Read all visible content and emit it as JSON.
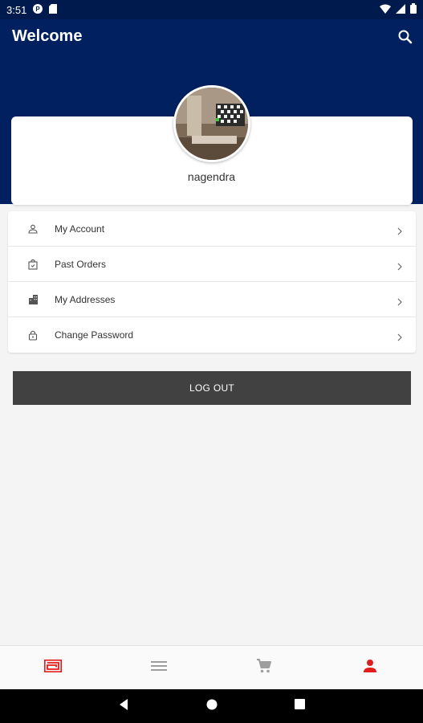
{
  "status_bar": {
    "time": "3:51"
  },
  "header": {
    "title": "Welcome"
  },
  "profile": {
    "username": "nagendra"
  },
  "menu": [
    {
      "label": "My Account",
      "icon": "person-icon"
    },
    {
      "label": "Past Orders",
      "icon": "shopping-bag-icon"
    },
    {
      "label": "My Addresses",
      "icon": "building-icon"
    },
    {
      "label": "Change Password",
      "icon": "lock-icon"
    }
  ],
  "logout": {
    "label": "LOG OUT"
  },
  "colors": {
    "header_bg": "#00205f",
    "accent": "#e21b1b",
    "button_dark": "#414141"
  },
  "bottom_nav": {
    "tabs": [
      {
        "icon": "store-logo-icon",
        "active": true
      },
      {
        "icon": "menu-icon",
        "active": false
      },
      {
        "icon": "cart-icon",
        "active": false
      },
      {
        "icon": "profile-icon",
        "active": true
      }
    ]
  }
}
